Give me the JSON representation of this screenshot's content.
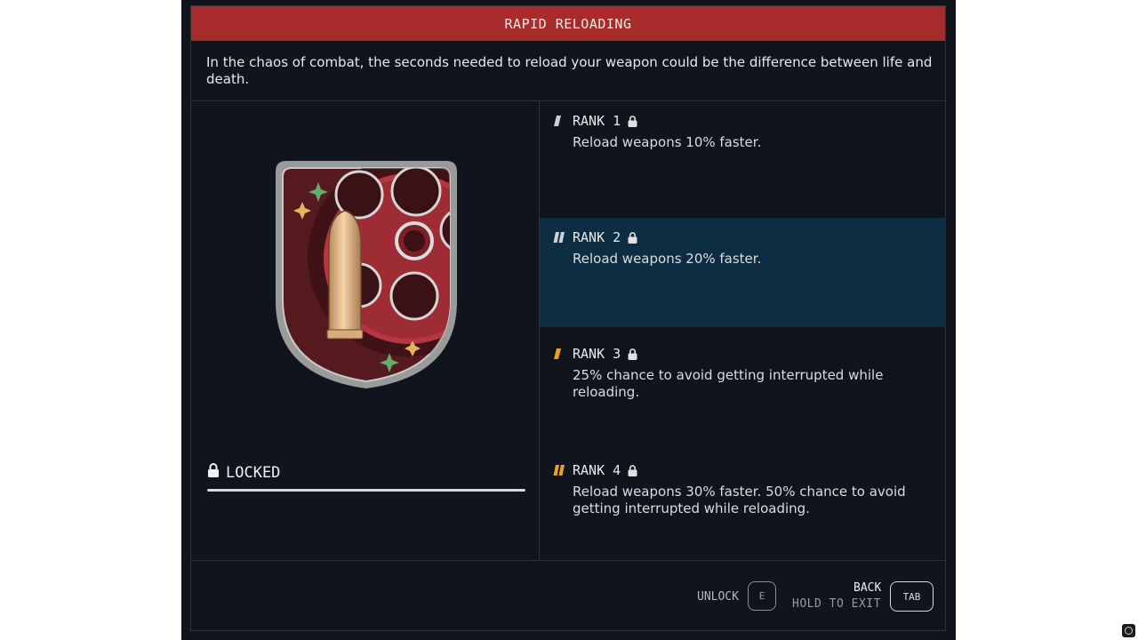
{
  "header": {
    "title": "RAPID RELOADING"
  },
  "description": "In the chaos of combat, the seconds needed to reload your weapon could be the difference between life and death.",
  "badge": {
    "icon": "rapid-reloading-badge-icon"
  },
  "status": {
    "label": "LOCKED",
    "icon": "lock-icon",
    "progress": 1.0
  },
  "ranks": [
    {
      "label": "RANK 1",
      "text": "Reload weapons 10% faster.",
      "marker": "single-bar",
      "marker_color": "#d0d0d0",
      "selected": false
    },
    {
      "label": "RANK 2",
      "text": "Reload weapons 20% faster.",
      "marker": "double-bar",
      "marker_color": "#d0d0d0",
      "selected": true
    },
    {
      "label": "RANK 3",
      "text": "25% chance to avoid getting interrupted while reloading.",
      "marker": "single-bar",
      "marker_color": "#e8a51c",
      "selected": false
    },
    {
      "label": "RANK 4",
      "text": "Reload weapons 30% faster. 50% chance to avoid getting interrupted while reloading.",
      "marker": "double-bar",
      "marker_color": "#e8a51c",
      "selected": false
    }
  ],
  "footer": {
    "unlock_label": "UNLOCK",
    "unlock_key": "E",
    "back_label": "BACK",
    "exit_label": "HOLD TO EXIT",
    "back_key": "TAB"
  },
  "colors": {
    "title_bar": "#a62b2a",
    "panel_bg": "#0f141d",
    "selected_row": "#0c2d42",
    "accent_gold": "#e8a51c"
  }
}
